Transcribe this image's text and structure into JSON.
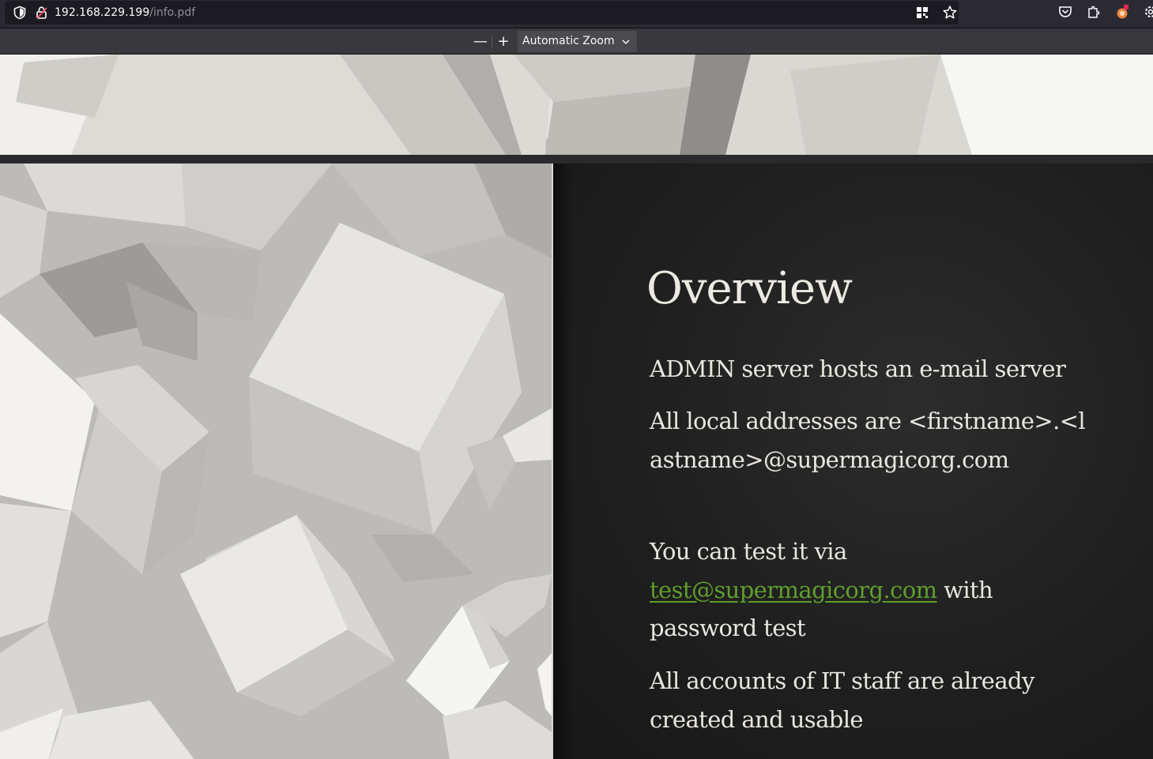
{
  "browser": {
    "url_host": "192.168.229.199",
    "url_path": "/info.pdf",
    "icons": [
      "shield-icon",
      "lock-warning-icon",
      "qr-code-icon",
      "bookmark-star-icon",
      "pocket-icon",
      "extensions-icon",
      "profile-icon",
      "settings-icon"
    ]
  },
  "pdf_toolbar": {
    "zoom_out": "—",
    "zoom_in": "+",
    "zoom_value": "Automatic Zoom"
  },
  "slide": {
    "title": "Overview",
    "bullet1": "ADMIN server hosts an e-mail server",
    "bullet2": "All local addresses are <firstname>.<lastname>@supermagicorg.com",
    "bullet3_pre": "You can test it via ",
    "bullet3_link": "test@supermagicorg.com",
    "bullet3_post": " with password test",
    "bullet4": "All accounts of IT staff are already created and usable"
  },
  "colors": {
    "slide_background": "#1f1f1f",
    "slide_text": "#e9e6df",
    "link": "#5e9e2d"
  }
}
